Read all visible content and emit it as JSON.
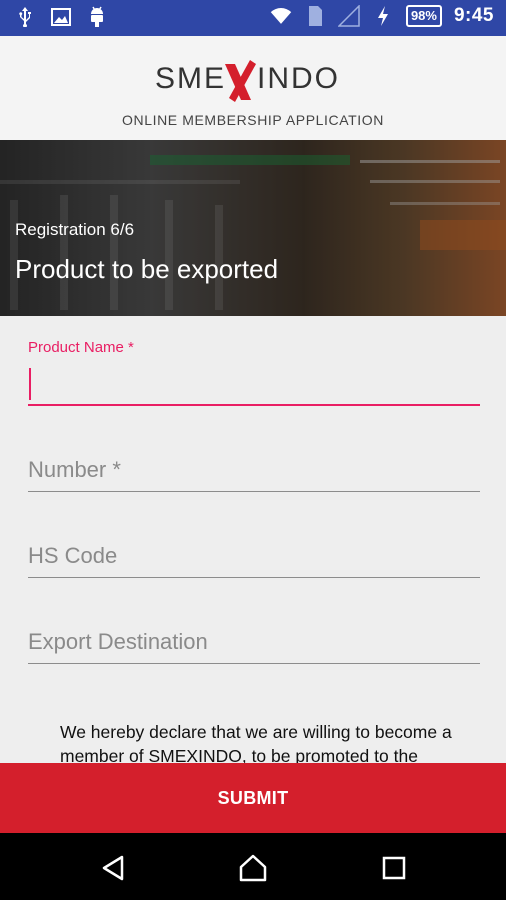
{
  "status_bar": {
    "icons_left": [
      "usb-icon",
      "image-icon",
      "android-icon"
    ],
    "icons_right": [
      "wifi-icon",
      "sim-icon",
      "signal-icon",
      "charging-icon"
    ],
    "battery": "98%",
    "time": "9:45",
    "background": "#2f47a6"
  },
  "header": {
    "logo_text": "SMEXINDO",
    "subtitle": "ONLINE MEMBERSHIP APPLICATION",
    "logo_accent": "#d41f2c"
  },
  "banner": {
    "step": "Registration 6/6",
    "title": "Product to be exported"
  },
  "form": {
    "product_name": {
      "label": "Product Name *",
      "value": ""
    },
    "number": {
      "placeholder": "Number *"
    },
    "hs_code": {
      "placeholder": "HS Code"
    },
    "export_destination": {
      "placeholder": "Export Destination"
    },
    "accent": "#e91e63"
  },
  "declaration": "We hereby declare that we are willing to become a member of SMEXINDO, to be promoted to the",
  "submit": {
    "label": "SUBMIT",
    "color": "#d41f2c"
  },
  "nav_bar": {
    "buttons": [
      "back-icon",
      "home-icon",
      "recents-icon"
    ]
  }
}
